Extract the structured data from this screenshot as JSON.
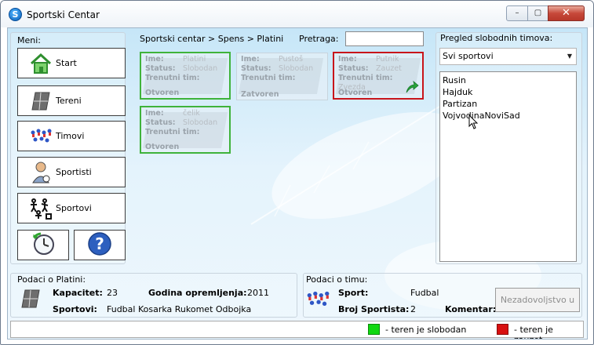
{
  "window": {
    "title": "Sportski Centar",
    "minimize_glyph": "–",
    "maximize_glyph": "▢",
    "close_glyph": "✕",
    "app_icon_glyph": "S"
  },
  "menu": {
    "title": "Meni:",
    "items": [
      {
        "label": "Start",
        "icon": "home-icon"
      },
      {
        "label": "Tereni",
        "icon": "court-icon"
      },
      {
        "label": "Timovi",
        "icon": "team-icon"
      },
      {
        "label": "Sportisti",
        "icon": "athlete-icon"
      },
      {
        "label": "Sportovi",
        "icon": "sports-icon"
      }
    ],
    "bottom_buttons": [
      {
        "icon": "clock-icon"
      },
      {
        "icon": "help-icon"
      }
    ]
  },
  "breadcrumb": "Sportski centar > Spens > Platini",
  "search": {
    "label": "Pretraga:",
    "value": ""
  },
  "court_labels": {
    "name": "Ime:",
    "status": "Status:",
    "team": "Trenutni tim:"
  },
  "courts": [
    {
      "name": "Platini",
      "status": "Slobodan",
      "team": "",
      "state": "Otvoren",
      "availability": "free",
      "selected": true
    },
    {
      "name": "Pustoš",
      "status": "Slobodan",
      "team": "",
      "state": "Zatvoren",
      "availability": "closed",
      "selected": false
    },
    {
      "name": "Putnik",
      "status": "Zauzet",
      "team": "Zvezda",
      "state": "Otvoren",
      "availability": "busy",
      "selected": false
    },
    {
      "name": "čelik",
      "status": "Slobodan",
      "team": "",
      "state": "Otvoren",
      "availability": "free",
      "selected": false
    }
  ],
  "teams_panel": {
    "title": "Pregled slobodnih timova:",
    "filter_value": "Svi sportovi",
    "teams": [
      "Rusin",
      "Hajduk",
      "Partizan",
      "VojvodinaNoviSad"
    ]
  },
  "court_info": {
    "title": "Podaci o Platini:",
    "capacity_label": "Kapacitet:",
    "capacity_value": "23",
    "year_label": "Godina opremljenja:",
    "year_value": "2011",
    "sports_label": "Sportovi:",
    "sports_value": "Fudbal Kosarka Rukomet Odbojka"
  },
  "team_info": {
    "title": "Podaci o timu:",
    "sport_label": "Sport:",
    "sport_value": "Fudbal",
    "count_label": "Broj Sportista:",
    "count_value": "2",
    "comment_label": "Komentar:",
    "button_label": "Nezadovoljstvo u"
  },
  "legend": {
    "free_label": "- teren je slobodan",
    "busy_label": "- teren je zauzet",
    "free_color": "#10d810",
    "busy_color": "#d81010"
  },
  "colors": {
    "selected_border": "#3fb33b",
    "busy_border": "#c8151b"
  }
}
